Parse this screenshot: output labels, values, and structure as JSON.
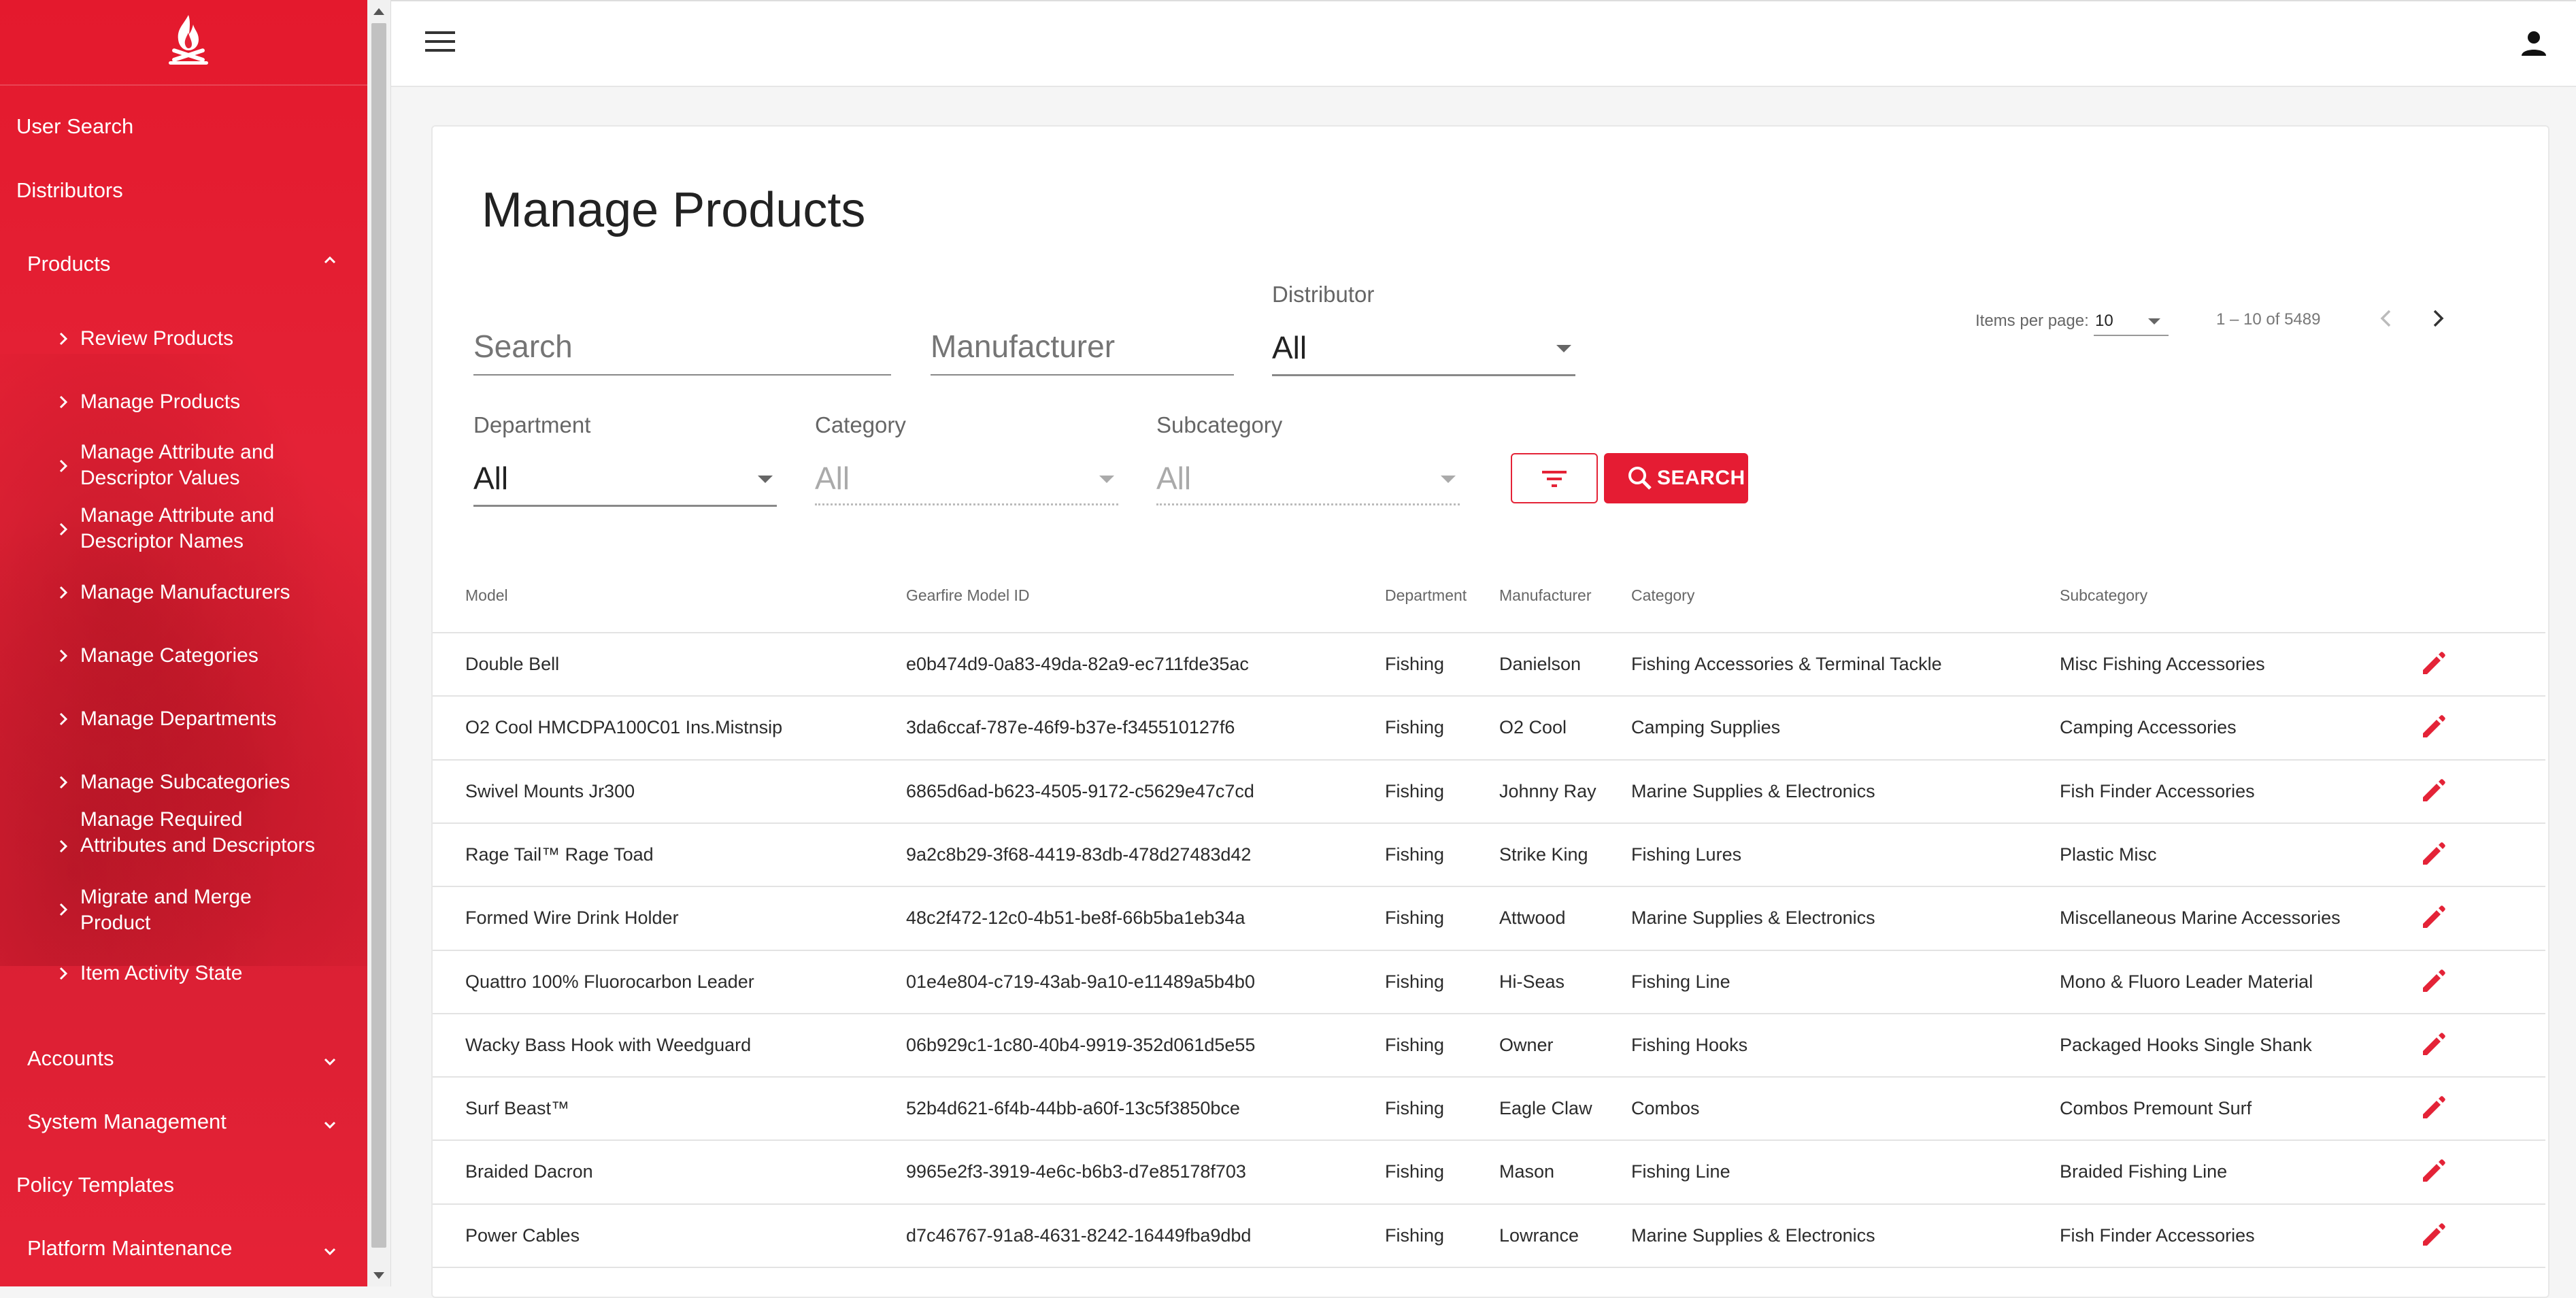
{
  "sidebar": {
    "items": [
      {
        "label": "User Search"
      },
      {
        "label": "Distributors"
      },
      {
        "label": "Products",
        "expanded": true
      },
      {
        "label": "Accounts"
      },
      {
        "label": "System Management"
      },
      {
        "label": "Policy Templates"
      },
      {
        "label": "Platform Maintenance"
      }
    ],
    "product_children": [
      {
        "label": "Review Products"
      },
      {
        "label": "Manage Products"
      },
      {
        "label": "Manage Attribute and Descriptor Values"
      },
      {
        "label": "Manage Attribute and Descriptor Names"
      },
      {
        "label": "Manage Manufacturers"
      },
      {
        "label": "Manage Categories"
      },
      {
        "label": "Manage Departments"
      },
      {
        "label": "Manage Subcategories"
      },
      {
        "label": "Manage Required Attributes and Descriptors"
      },
      {
        "label": "Migrate and Merge Product"
      },
      {
        "label": "Item Activity State"
      }
    ]
  },
  "header": {
    "menu_icon": "menu-icon",
    "account_icon": "account-icon"
  },
  "main": {
    "title": "Manage Products",
    "filters": {
      "search_placeholder": "Search",
      "manufacturer_placeholder": "Manufacturer",
      "distributor_label": "Distributor",
      "distributor_value": "All",
      "department_label": "Department",
      "department_value": "All",
      "category_label": "Category",
      "category_value": "All",
      "subcategory_label": "Subcategory",
      "subcategory_value": "All",
      "search_button": "SEARCH"
    },
    "paginator": {
      "items_per_page_label": "Items per page:",
      "items_per_page_value": "10",
      "range": "1 – 10 of 5489"
    },
    "table": {
      "columns": [
        "Model",
        "Gearfire Model ID",
        "Department",
        "Manufacturer",
        "Category",
        "Subcategory"
      ],
      "rows": [
        [
          "Double Bell",
          "e0b474d9-0a83-49da-82a9-ec711fde35ac",
          "Fishing",
          "Danielson",
          "Fishing Accessories & Terminal Tackle",
          "Misc Fishing Accessories"
        ],
        [
          "O2 Cool HMCDPA100C01 Ins.Mistnsip",
          "3da6ccaf-787e-46f9-b37e-f345510127f6",
          "Fishing",
          "O2 Cool",
          "Camping Supplies",
          "Camping Accessories"
        ],
        [
          "Swivel Mounts Jr300",
          "6865d6ad-b623-4505-9172-c5629e47c7cd",
          "Fishing",
          "Johnny Ray",
          "Marine Supplies & Electronics",
          "Fish Finder Accessories"
        ],
        [
          "Rage Tail™ Rage Toad",
          "9a2c8b29-3f68-4419-83db-478d27483d42",
          "Fishing",
          "Strike King",
          "Fishing Lures",
          "Plastic Misc"
        ],
        [
          "Formed Wire Drink Holder",
          "48c2f472-12c0-4b51-be8f-66b5ba1eb34a",
          "Fishing",
          "Attwood",
          "Marine Supplies & Electronics",
          "Miscellaneous Marine Accessories"
        ],
        [
          "Quattro 100% Fluorocarbon Leader",
          "01e4e804-c719-43ab-9a10-e11489a5b4b0",
          "Fishing",
          "Hi-Seas",
          "Fishing Line",
          "Mono & Fluoro Leader Material"
        ],
        [
          "Wacky Bass Hook with Weedguard",
          "06b929c1-1c80-40b4-9919-352d061d5e55",
          "Fishing",
          "Owner",
          "Fishing Hooks",
          "Packaged Hooks Single Shank"
        ],
        [
          "Surf Beast™",
          "52b4d621-6f4b-44bb-a60f-13c5f3850bce",
          "Fishing",
          "Eagle Claw",
          "Combos",
          "Combos Premount Surf"
        ],
        [
          "Braided Dacron",
          "9965e2f3-3919-4e6c-b6b3-d7e85178f703",
          "Fishing",
          "Mason",
          "Fishing Line",
          "Braided Fishing Line"
        ],
        [
          "Power Cables",
          "d7c46767-91a8-4631-8242-16449fba9dbd",
          "Fishing",
          "Lowrance",
          "Marine Supplies & Electronics",
          "Fish Finder Accessories"
        ]
      ]
    }
  },
  "colors": {
    "brand_red": "#e42337",
    "sidebar_bg": "#e31f33"
  }
}
